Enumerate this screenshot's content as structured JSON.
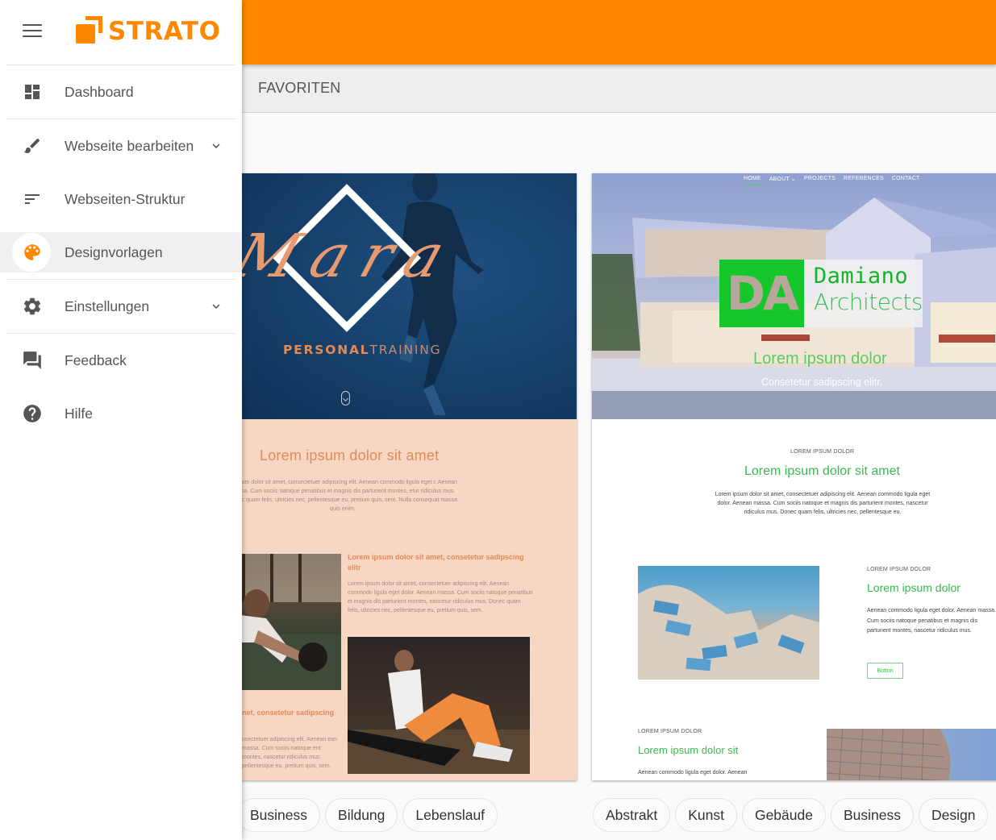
{
  "app": {
    "brand": "STRATO",
    "accent": "#ff8800"
  },
  "sidebar": {
    "items": [
      {
        "label": "Dashboard",
        "icon": "dashboard-icon"
      },
      {
        "label": "Webseite bearbeiten",
        "icon": "brush-icon",
        "expandable": true
      },
      {
        "label": "Webseiten-Struktur",
        "icon": "sort-lines-icon"
      },
      {
        "label": "Designvorlagen",
        "icon": "palette-icon",
        "active": true
      },
      {
        "label": "Einstellungen",
        "icon": "gear-icon",
        "expandable": true
      },
      {
        "label": "Feedback",
        "icon": "chat-bubbles-icon"
      },
      {
        "label": "Hilfe",
        "icon": "help-circle-icon"
      }
    ]
  },
  "section": {
    "title": "FAVORITEN"
  },
  "templates": [
    {
      "name": "Mara Personal Training",
      "preview": {
        "script_title": "Mara",
        "subtitle_bold": "PERSONAL",
        "subtitle_light": "TRAINING",
        "heading": "Lorem ipsum dolor sit amet",
        "paragraph": "m ipsum dolor sit amet, consectetuer adipiscing elit. Aenean commodo ligula eget r. Aenean massa. Cum sociis natoque penatibus et magnis dis parturient montes, etur ridiculus mus. Donec quam felis, ultricies nec, pellentesque eu, pretium quis, sem. Nulla consequat massa quis enim.",
        "block_heading": "Lorem ipsum dolor sit amet, consetetur sadipscing elitr",
        "block_paragraph": "Lorem ipsum dolor sit amet, consectetuer adipiscing elit. Aenean commodo ligula eget dolor. Aenean massa. Cum sociis natoque penatibus et magnis dis parturient montes, nascetur ridiculus mus. Donec quam felis, ultricies nec, pellentesque eu, pretium quis, sem.",
        "block2_heading": "net, consetetur sadipscing",
        "block2_paragraph": "nsectetuer adipiscing elit. Aenean ean massa. Cum sociis natoque ent montes, nascetur ridiculus mus. pellentesque eu, pretium quis, sem."
      },
      "tags": [
        "Business",
        "Bildung",
        "Lebenslauf"
      ]
    },
    {
      "name": "Damiano Architects",
      "preview": {
        "nav": [
          "HOME",
          "ABOUT ⌄",
          "PROJECTS",
          "REFERENCES",
          "CONTACT"
        ],
        "logo_initials": "DA",
        "logo_line1": "Damiano",
        "logo_line2": "Architects",
        "hero_title": "Lorem ipsum dolor",
        "hero_sub": "Consetetur sadipscing elitr.",
        "kicker1": "LOREM IPSUM DOLOR",
        "heading1": "Lorem ipsum dolor sit amet",
        "paragraph1": "Lorem ipsum dolor sit amet, consectetuer adipiscing elit. Aenean commodo ligula eget dolor. Aenean massa. Cum sociis natoque et magnis dis parturient montes, nascetur ridiculus mus. Donec quam felis, ultricies nec, pellentesque eu.",
        "kicker2": "LOREM IPSUM DOLOR",
        "heading2": "Lorem ipsum dolor",
        "paragraph2": "Aenean commodo ligula eget dolor. Aenean massa. Cum sociis natoque penatibus et magnis dis parturient montes, nascetur ridiculus mus.",
        "button": "Button",
        "kicker3": "LOREM IPSUM DOLOR",
        "heading3": "Lorem ipsum dolor sit",
        "paragraph3": "Aenean commodo ligula eget dolor. Aenean"
      },
      "tags": [
        "Abstrakt",
        "Kunst",
        "Gebäude",
        "Business",
        "Design"
      ]
    }
  ]
}
